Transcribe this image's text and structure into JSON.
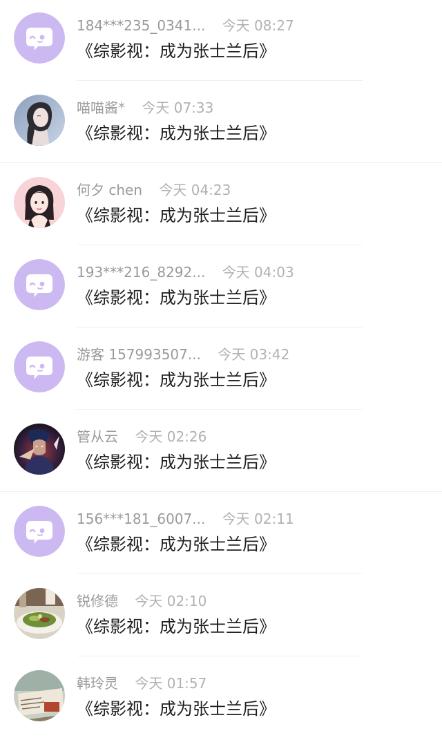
{
  "comments": [
    {
      "username": "184***235_0341...",
      "time": "今天 08:27",
      "title": "《综影视：成为张士兰后》",
      "avatar": "default-chat-bubble-icon"
    },
    {
      "username": "喵喵酱*",
      "time": "今天 07:33",
      "title": "《综影视：成为张士兰后》",
      "avatar": "user-photo-avatar"
    },
    {
      "username": "何夕 chen",
      "time": "今天 04:23",
      "title": "《综影视：成为张士兰后》",
      "avatar": "cartoon-girl-avatar"
    },
    {
      "username": "193***216_8292...",
      "time": "今天 04:03",
      "title": "《综影视：成为张士兰后》",
      "avatar": "default-chat-bubble-icon"
    },
    {
      "username": "游客 157993507...",
      "time": "今天 03:42",
      "title": "《综影视：成为张士兰后》",
      "avatar": "default-chat-bubble-icon"
    },
    {
      "username": "管从云",
      "time": "今天 02:26",
      "title": "《综影视：成为张士兰后》",
      "avatar": "game-character-avatar"
    },
    {
      "username": "156***181_6007...",
      "time": "今天 02:11",
      "title": "《综影视：成为张士兰后》",
      "avatar": "default-chat-bubble-icon"
    },
    {
      "username": "锐修德",
      "time": "今天 02:10",
      "title": "《综影视：成为张士兰后》",
      "avatar": "food-photo-avatar"
    },
    {
      "username": "韩玲灵",
      "time": "今天 01:57",
      "title": "《综影视：成为张士兰后》",
      "avatar": "book-photo-avatar"
    }
  ],
  "colors": {
    "default_avatar_bg": "#cdb9f2",
    "username": "#9a9a9a",
    "timestamp": "#b1b1b1",
    "title": "#1f1f1f",
    "divider": "#f0f0f0"
  }
}
